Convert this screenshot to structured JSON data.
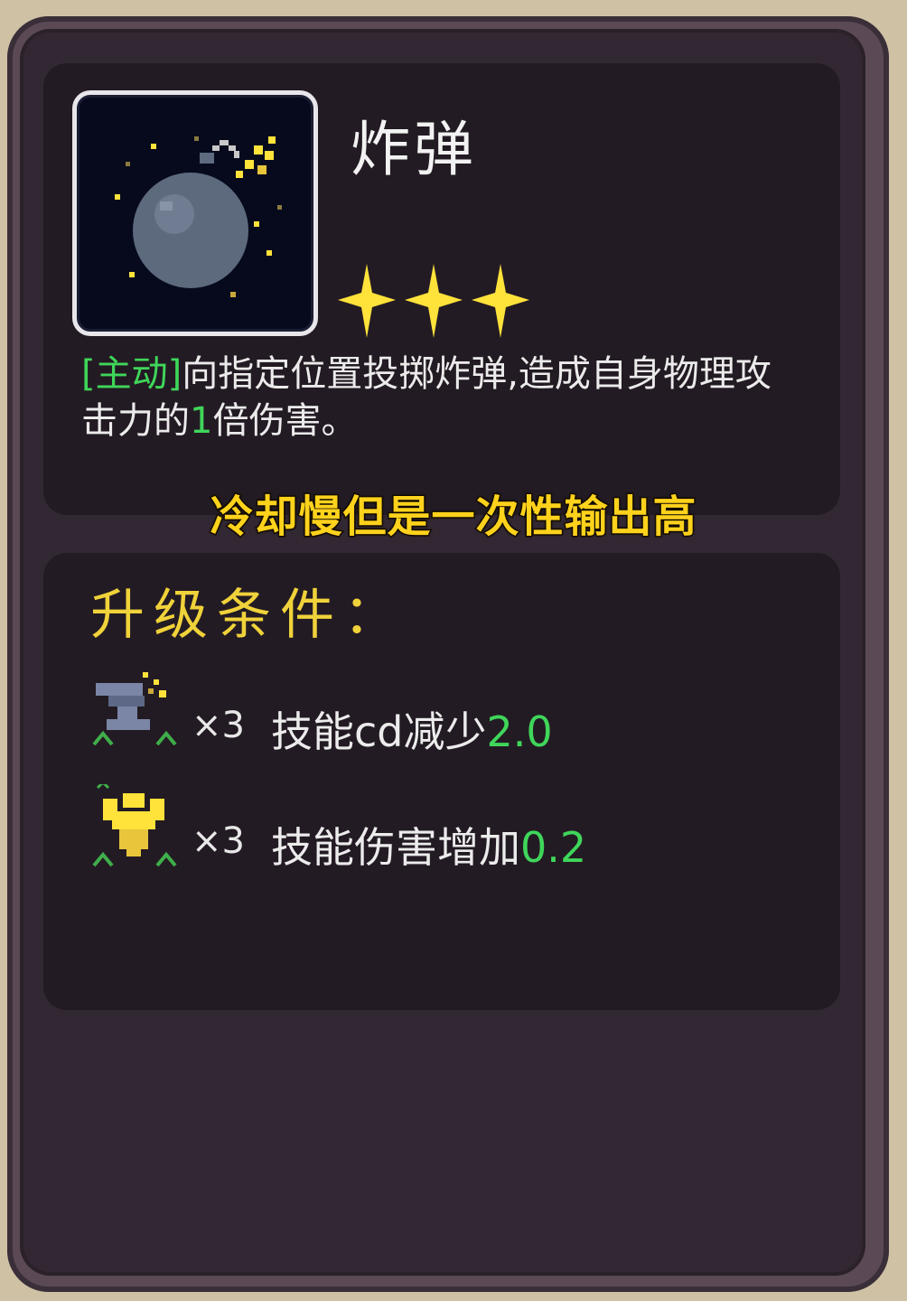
{
  "item": {
    "name": "炸弹",
    "stars": 3,
    "icon": "bomb-icon",
    "desc_tag": "[主动]",
    "desc_part1": "向指定位置投掷炸弹,造成自身物理攻击力的",
    "desc_num": "1",
    "desc_part2": "倍伤害。"
  },
  "note": "冷却慢但是一次性输出高",
  "upgrade": {
    "title": "升级条件：",
    "conditions": [
      {
        "icon": "anvil-icon",
        "mult": "×3",
        "text": "技能cd减少",
        "value": "2.0"
      },
      {
        "icon": "strength-icon",
        "mult": "×3",
        "text": "技能伤害增加",
        "value": "0.2"
      }
    ]
  },
  "colors": {
    "green": "#3fd65a",
    "gold": "#f0d23a",
    "star": "#ffe23a"
  }
}
